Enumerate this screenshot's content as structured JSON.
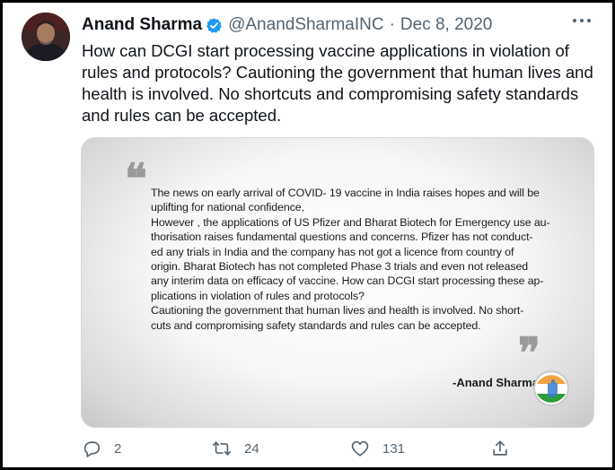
{
  "tweet": {
    "author_name": "Anand Sharma",
    "handle": "@AnandSharmaINC",
    "separator": "·",
    "date": "Dec 8, 2020",
    "text": "How can DCGI start processing vaccine applications in violation of rules and protocols? Cautioning the government that human lives and health is involved. No shortcuts and compromising safety standards and rules can be accepted."
  },
  "media": {
    "quote_open": "❝",
    "quote_close": "❞",
    "lines": [
      "The news on  early arrival of COVID- 19 vaccine in India raises hopes and will be",
      "uplifting for national confidence,",
      "However , the applications of US Pfizer and Bharat Biotech for Emergency use au-",
      "thorisation raises fundamental questions and concerns. Pfizer has not conduct-",
      "ed any trials in India and the company has not got a licence from country of",
      "origin. Bharat Biotech  has not completed Phase 3 trials and even not released",
      "any interim data on efficacy of vaccine. How can DCGI start processing these ap-",
      "plications in violation of rules and protocols?",
      "Cautioning the government that human lives and health is involved. No short-",
      "cuts  and compromising safety standards and rules can be accepted."
    ],
    "signature": "-Anand Sharma",
    "logo_colors": {
      "saffron": "#f4a340",
      "white": "#ffffff",
      "green": "#2e9c3a"
    }
  },
  "actions": {
    "reply_count": "2",
    "retweet_count": "24",
    "like_count": "131"
  },
  "colors": {
    "text": "#0f1419",
    "secondary": "#536471",
    "verified": "#1d9bf0"
  }
}
